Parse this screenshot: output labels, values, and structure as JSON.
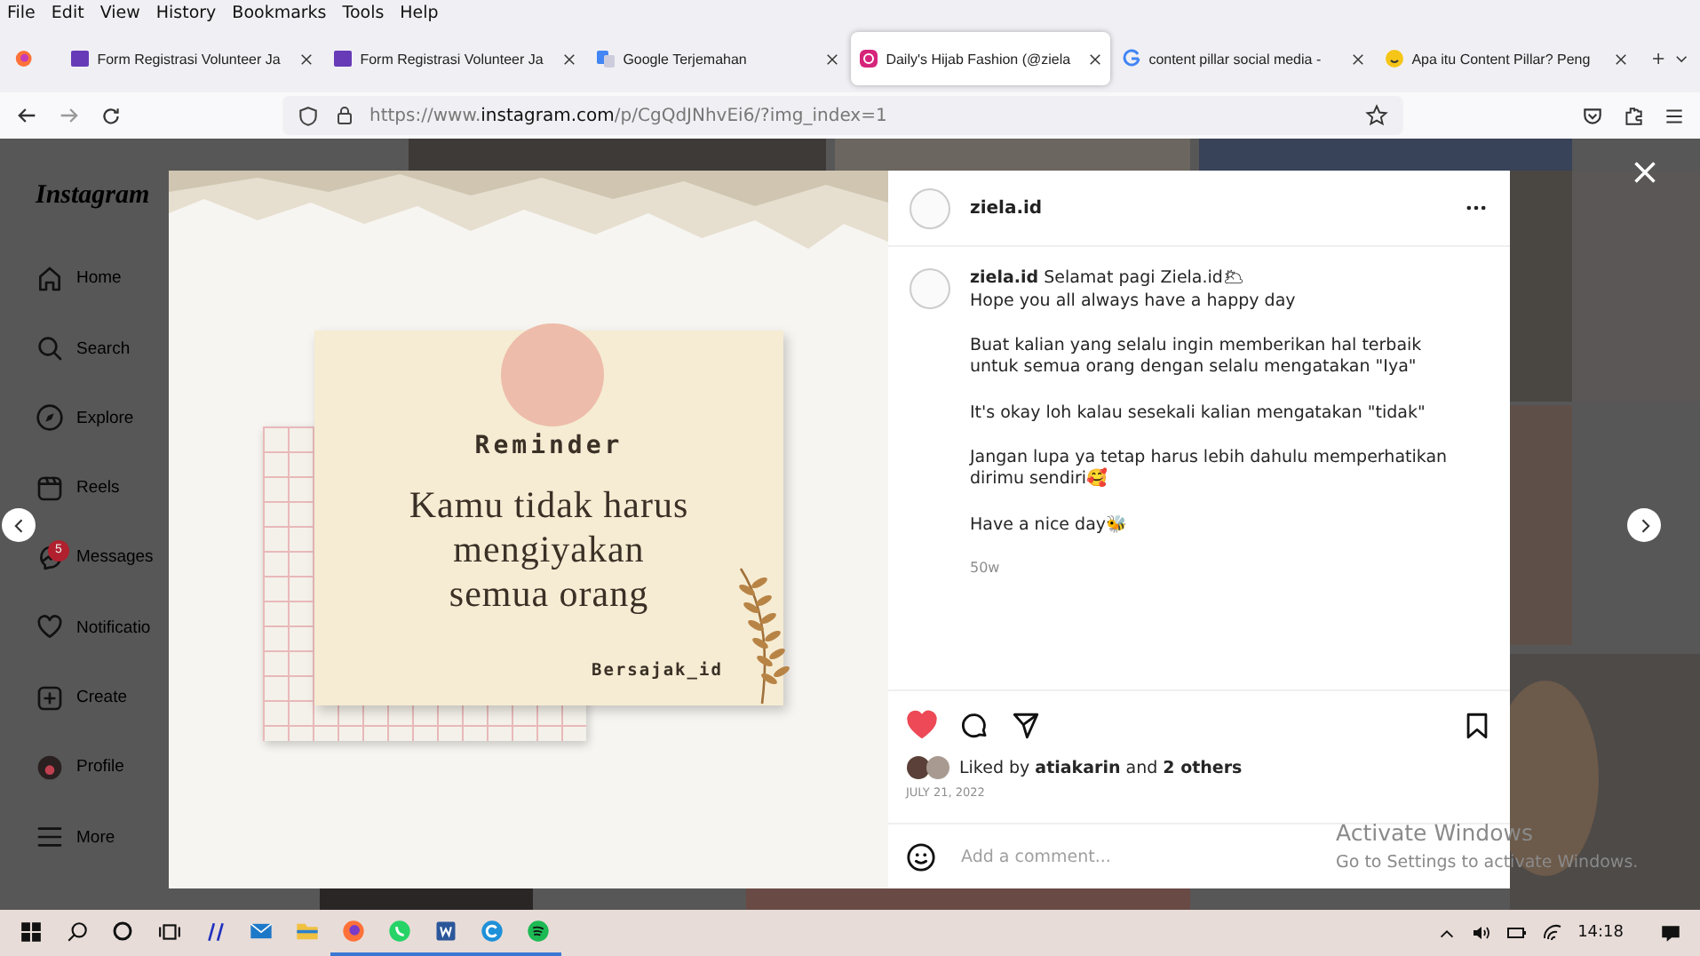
{
  "menu": [
    "File",
    "Edit",
    "View",
    "History",
    "Bookmarks",
    "Tools",
    "Help"
  ],
  "tabs": [
    {
      "title": "Form Registrasi Volunteer Ja",
      "kind": "form",
      "selected": false
    },
    {
      "title": "Form Registrasi Volunteer Ja",
      "kind": "form",
      "selected": false
    },
    {
      "title": "Google Terjemahan",
      "kind": "translate",
      "selected": false
    },
    {
      "title": "Daily's Hijab Fashion (@ziela",
      "kind": "instagram",
      "selected": true
    },
    {
      "title": "content pillar social media -",
      "kind": "google",
      "selected": false
    },
    {
      "title": "Apa itu Content Pillar? Peng",
      "kind": "smile",
      "selected": false
    }
  ],
  "url": {
    "prefix": "https://www.",
    "domain": "instagram.com",
    "path": "/p/CgQdJNhvEi6/?img_index=1"
  },
  "sidebar": {
    "logo": "Instagram",
    "items": [
      {
        "label": "Home",
        "kind": "home"
      },
      {
        "label": "Search",
        "kind": "search"
      },
      {
        "label": "Explore",
        "kind": "explore"
      },
      {
        "label": "Reels",
        "kind": "reels"
      },
      {
        "label": "Messages",
        "kind": "messages",
        "badge": "5"
      },
      {
        "label": "Notificatio",
        "kind": "heart"
      },
      {
        "label": "Create",
        "kind": "create"
      },
      {
        "label": "Profile",
        "kind": "profile"
      },
      {
        "label": "More",
        "kind": "more"
      }
    ]
  },
  "post_image": {
    "heading": "Reminder",
    "lines": [
      "Kamu tidak harus",
      "mengiyakan",
      "semua orang"
    ],
    "signature": "Bersajak_id"
  },
  "post": {
    "username": "ziela.id",
    "caption_user": "ziela.id",
    "caption": [
      [
        "Selamat pagi Ziela.id🌥",
        "Hope you all always have a happy day"
      ],
      [
        "Buat kalian yang selalu ingin memberikan hal terbaik untuk semua orang dengan selalu mengatakan \"Iya\""
      ],
      [
        "It's okay loh kalau sesekali kalian mengatakan \"tidak\""
      ],
      [
        "Jangan lupa ya tetap harus lebih dahulu memperhatikan dirimu sendiri🥰"
      ],
      [
        "Have a nice day🐝"
      ]
    ],
    "age": "50w",
    "liked": true,
    "likes": "Liked by **atiakarin** and **2 others**",
    "date": "JULY 21, 2022",
    "comment_placeholder": "Add a comment..."
  },
  "activation": {
    "title": "Activate Windows",
    "subtitle": "Go to Settings to activate Windows."
  },
  "taskbar": {
    "apps": [
      {
        "kind": "firefox",
        "running": true
      },
      {
        "kind": "whatsapp",
        "running": true
      },
      {
        "kind": "word",
        "running": true
      },
      {
        "kind": "c",
        "running": true
      },
      {
        "kind": "spotify",
        "running": true
      }
    ],
    "time": "14:18"
  }
}
